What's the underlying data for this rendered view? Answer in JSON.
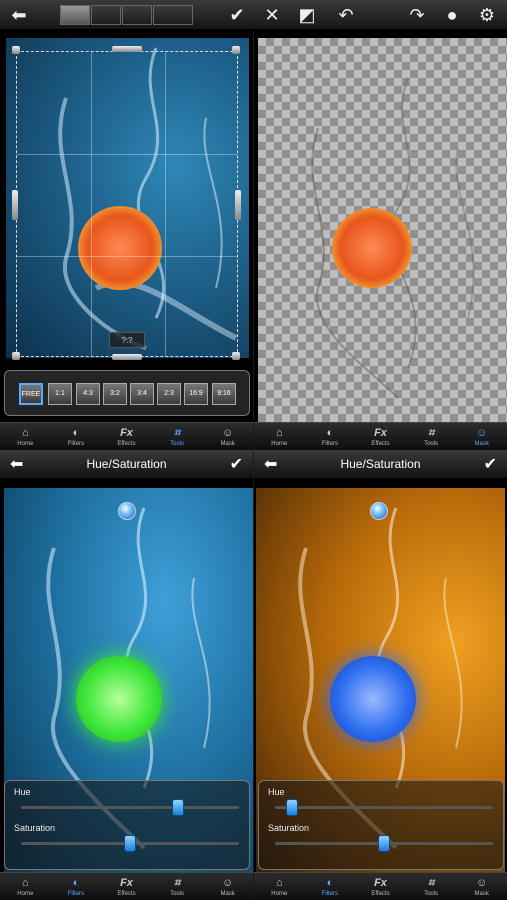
{
  "toolbar": {
    "crop_aspect_buttons": [
      "crop-free-icon",
      "crop-rotate-icon",
      "crop-skew-icon",
      "crop-frame-icon"
    ],
    "confirm_icon": "checkmark-icon",
    "cancel_icon": "close-icon",
    "mask_toggle_icon": "mask-contrast-icon",
    "undo_icon": "undo-icon",
    "redo_icon": "redo-icon",
    "brush_icon": "brush-dot-icon",
    "settings_icon": "gear-icon"
  },
  "crop": {
    "size_label": "?:?",
    "ratios": [
      "FREE",
      "1:1",
      "4:3",
      "3:2",
      "3:4",
      "2:3",
      "16:9",
      "9:16"
    ],
    "active_ratio": "FREE"
  },
  "tabs": [
    {
      "label": "Home",
      "icon": "home-icon"
    },
    {
      "label": "Filters",
      "icon": "filters-icon"
    },
    {
      "label": "Effects",
      "icon": "fx-icon"
    },
    {
      "label": "Tools",
      "icon": "crop-tool-icon"
    },
    {
      "label": "Mask",
      "icon": "mask-icon"
    }
  ],
  "fx_glyph": "Fx",
  "panel1_active_tab": "Tools",
  "panel2_active_tab": "Mask",
  "hue_sat_left": {
    "title": "Hue/Saturation",
    "hue_label": "Hue",
    "saturation_label": "Saturation",
    "hue_value": 0.72,
    "saturation_value": 0.5,
    "active_tab": "Filters"
  },
  "hue_sat_right": {
    "title": "Hue/Saturation",
    "hue_label": "Hue",
    "saturation_label": "Saturation",
    "hue_value": 0.08,
    "saturation_value": 0.5,
    "active_tab": "Filters"
  },
  "colors": {
    "accent": "#5aa8ff",
    "fruit_original": "#e8561c",
    "fruit_green": "#3ee83a",
    "fruit_blue": "#2f6ff0"
  }
}
